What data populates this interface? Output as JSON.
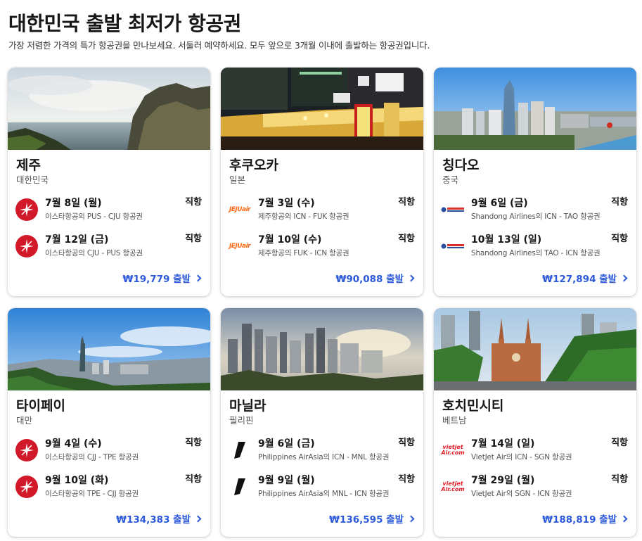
{
  "page": {
    "title": "대한민국 출발 최저가 항공권",
    "subtitle": "가장 저렴한 가격의 특가 항공권을 만나보세요. 서둘러 예약하세요. 모두 앞으로 3개월 이내에 출발하는 항공권입니다."
  },
  "colors": {
    "accent": "#2b59d9",
    "eastar": "#d1192a",
    "jeju": "#ff6a13",
    "vietjet": "#e01b24"
  },
  "cards": [
    {
      "city": "제주",
      "country": "대한민국",
      "image_icon": "jeju-coast-photo",
      "flights": [
        {
          "date": "7월 8일 (월)",
          "desc": "이스타항공의 PUS - CJU 항공권",
          "stops": "직항",
          "logo": "eastar-logo"
        },
        {
          "date": "7월 12일 (금)",
          "desc": "이스타항공의 CJU - PUS 항공권",
          "stops": "직항",
          "logo": "eastar-logo"
        }
      ],
      "price": "₩19,779 출발"
    },
    {
      "city": "후쿠오카",
      "country": "일본",
      "image_icon": "fukuoka-street-photo",
      "flights": [
        {
          "date": "7월 3일 (수)",
          "desc": "제주항공의 ICN - FUK 항공권",
          "stops": "직항",
          "logo": "jejuair-logo"
        },
        {
          "date": "7월 10일 (수)",
          "desc": "제주항공의 FUK - ICN 항공권",
          "stops": "직항",
          "logo": "jejuair-logo"
        }
      ],
      "price": "₩90,088 출발"
    },
    {
      "city": "칭다오",
      "country": "중국",
      "image_icon": "qingdao-skyline-photo",
      "flights": [
        {
          "date": "9월 6일 (금)",
          "desc": "Shandong Airlines의 ICN - TAO 항공권",
          "stops": "직항",
          "logo": "shandong-logo"
        },
        {
          "date": "10월 13일 (일)",
          "desc": "Shandong Airlines의 TAO - ICN 항공권",
          "stops": "직항",
          "logo": "shandong-logo"
        }
      ],
      "price": "₩127,894 출발"
    },
    {
      "city": "타이페이",
      "country": "대만",
      "image_icon": "taipei-skyline-photo",
      "flights": [
        {
          "date": "9월 4일 (수)",
          "desc": "이스타항공의 CJJ - TPE 항공권",
          "stops": "직항",
          "logo": "eastar-logo"
        },
        {
          "date": "9월 10일 (화)",
          "desc": "이스타항공의 TPE - CJJ 항공권",
          "stops": "직항",
          "logo": "eastar-logo"
        }
      ],
      "price": "₩134,383 출발"
    },
    {
      "city": "마닐라",
      "country": "필리핀",
      "image_icon": "manila-skyline-photo",
      "flights": [
        {
          "date": "9월 6일 (금)",
          "desc": "Philippines AirAsia의 ICN - MNL 항공권",
          "stops": "직항",
          "logo": "airasia-tail-logo"
        },
        {
          "date": "9월 9일 (월)",
          "desc": "Philippines AirAsia의 MNL - ICN 항공권",
          "stops": "직항",
          "logo": "airasia-tail-logo"
        }
      ],
      "price": "₩136,595 출발"
    },
    {
      "city": "호치민시티",
      "country": "베트남",
      "image_icon": "hochiminh-cathedral-photo",
      "flights": [
        {
          "date": "7월 14일 (일)",
          "desc": "VietJet Air의 ICN - SGN 항공권",
          "stops": "직항",
          "logo": "vietjet-logo"
        },
        {
          "date": "7월 29일 (월)",
          "desc": "VietJet Air의 SGN - ICN 항공권",
          "stops": "직항",
          "logo": "vietjet-logo"
        }
      ],
      "price": "₩188,819 출발"
    }
  ]
}
